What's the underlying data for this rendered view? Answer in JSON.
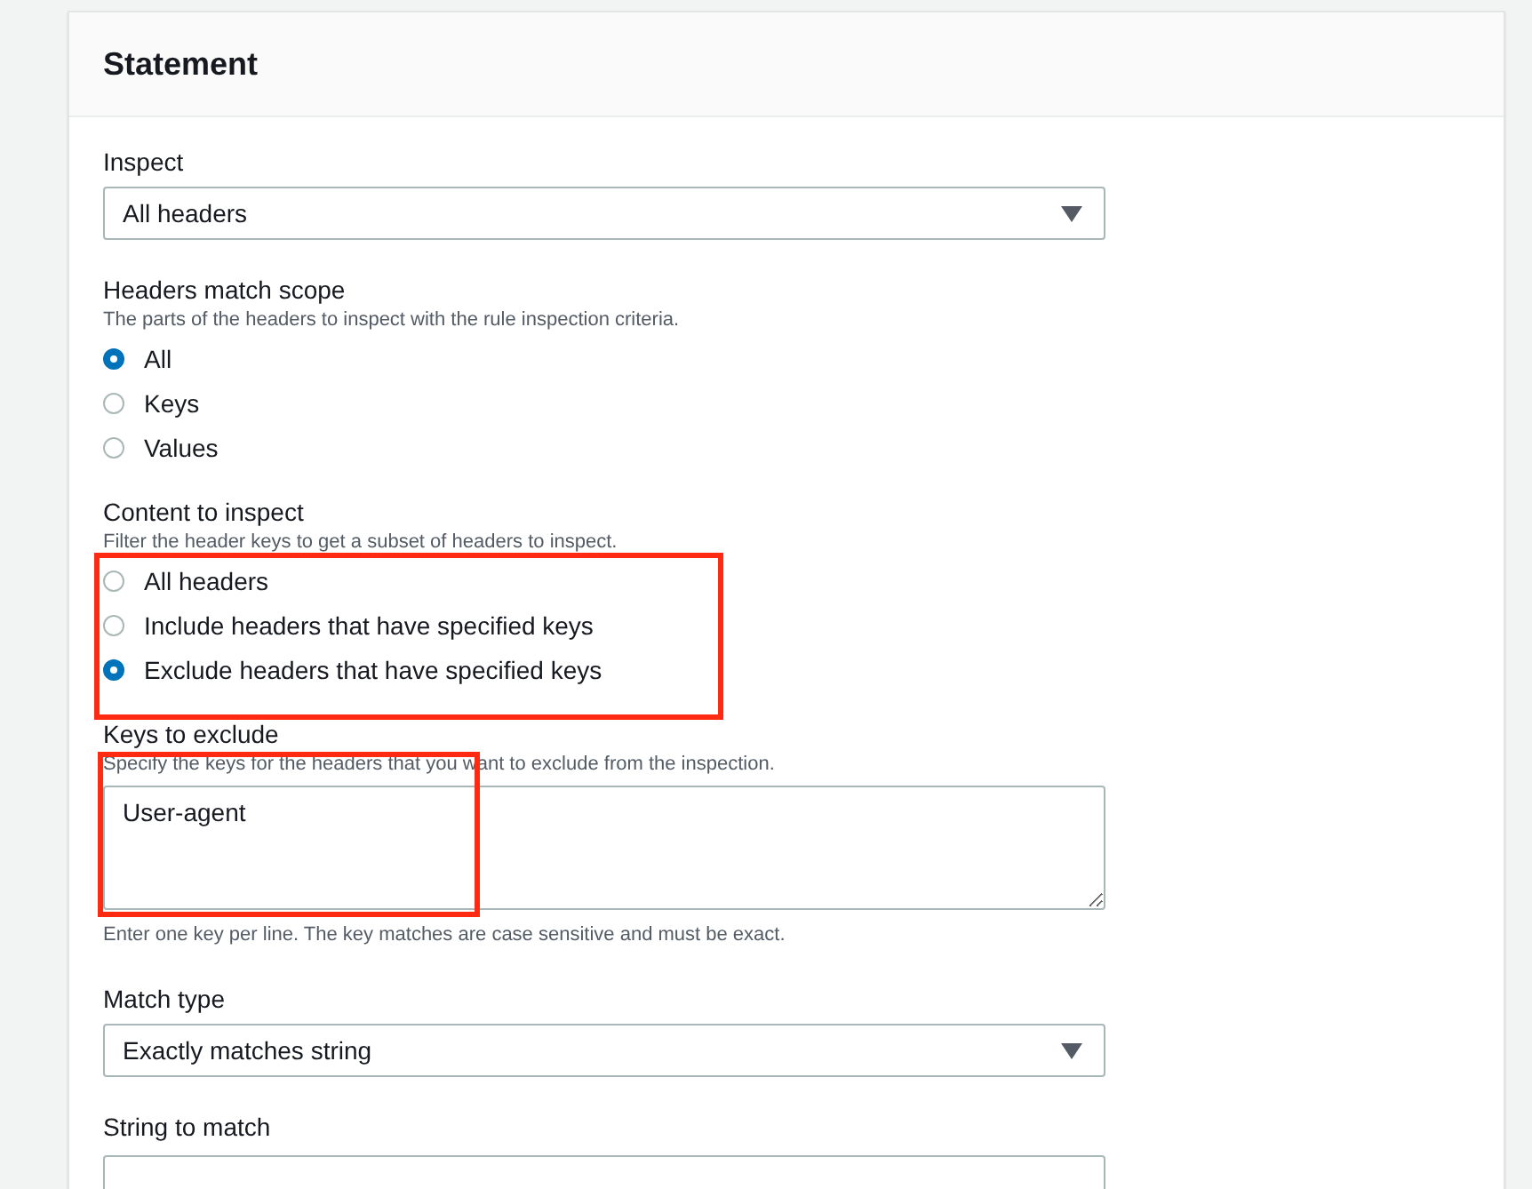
{
  "panel": {
    "title": "Statement"
  },
  "fields": [
    {
      "kind": "select",
      "label": "Inspect",
      "value": "All headers"
    },
    {
      "kind": "radio",
      "label": "Headers match scope",
      "description": "The parts of the headers to inspect with the rule inspection criteria.",
      "options": [
        {
          "label": "All",
          "selected": true
        },
        {
          "label": "Keys",
          "selected": false
        },
        {
          "label": "Values",
          "selected": false
        }
      ]
    },
    {
      "kind": "radio",
      "label": "Content to inspect",
      "description": "Filter the header keys to get a subset of headers to inspect.",
      "highlighted": true,
      "options": [
        {
          "label": "All headers",
          "selected": false
        },
        {
          "label": "Include headers that have specified keys",
          "selected": false
        },
        {
          "label": "Exclude headers that have specified keys",
          "selected": true
        }
      ]
    },
    {
      "kind": "textarea",
      "label": "Keys to exclude",
      "description": "Specify the keys for the headers that you want to exclude from the inspection.",
      "value": "User-agent",
      "hint": "Enter one key per line. The key matches are case sensitive and must be exact.",
      "highlighted": true
    },
    {
      "kind": "select",
      "label": "Match type",
      "value": "Exactly matches string"
    },
    {
      "kind": "text",
      "label": "String to match"
    }
  ]
}
